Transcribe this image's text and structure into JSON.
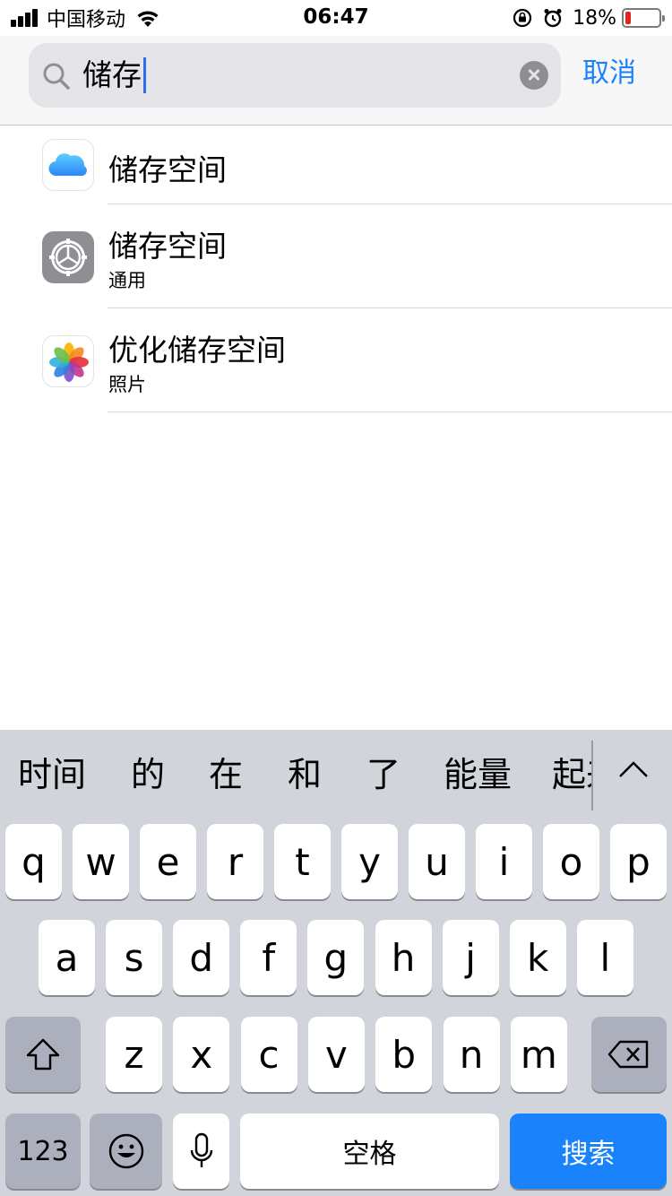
{
  "status_bar": {
    "carrier": "中国移动",
    "time": "06:47",
    "battery_percent": "18%",
    "battery_level": 0.18
  },
  "search": {
    "value": "储存",
    "cancel_label": "取消"
  },
  "results": [
    {
      "title": "储存空间",
      "subtitle": "",
      "icon": "icloud-icon"
    },
    {
      "title": "储存空间",
      "subtitle": "通用",
      "icon": "settings-gear-icon"
    },
    {
      "title": "优化储存空间",
      "subtitle": "照片",
      "icon": "photos-icon"
    }
  ],
  "keyboard": {
    "candidates": [
      "时间",
      "的",
      "在",
      "和",
      "了",
      "能量",
      "起来"
    ],
    "row1": [
      "q",
      "w",
      "e",
      "r",
      "t",
      "y",
      "u",
      "i",
      "o",
      "p"
    ],
    "row2": [
      "a",
      "s",
      "d",
      "f",
      "g",
      "h",
      "j",
      "k",
      "l"
    ],
    "row3": [
      "z",
      "x",
      "c",
      "v",
      "b",
      "n",
      "m"
    ],
    "numbers_label": "123",
    "space_label": "空格",
    "search_label": "搜索"
  },
  "colors": {
    "accent": "#1a82fb",
    "battery_low": "#e2261b",
    "keyboard_bg": "#d1d4db",
    "function_key": "#abb0bc"
  }
}
